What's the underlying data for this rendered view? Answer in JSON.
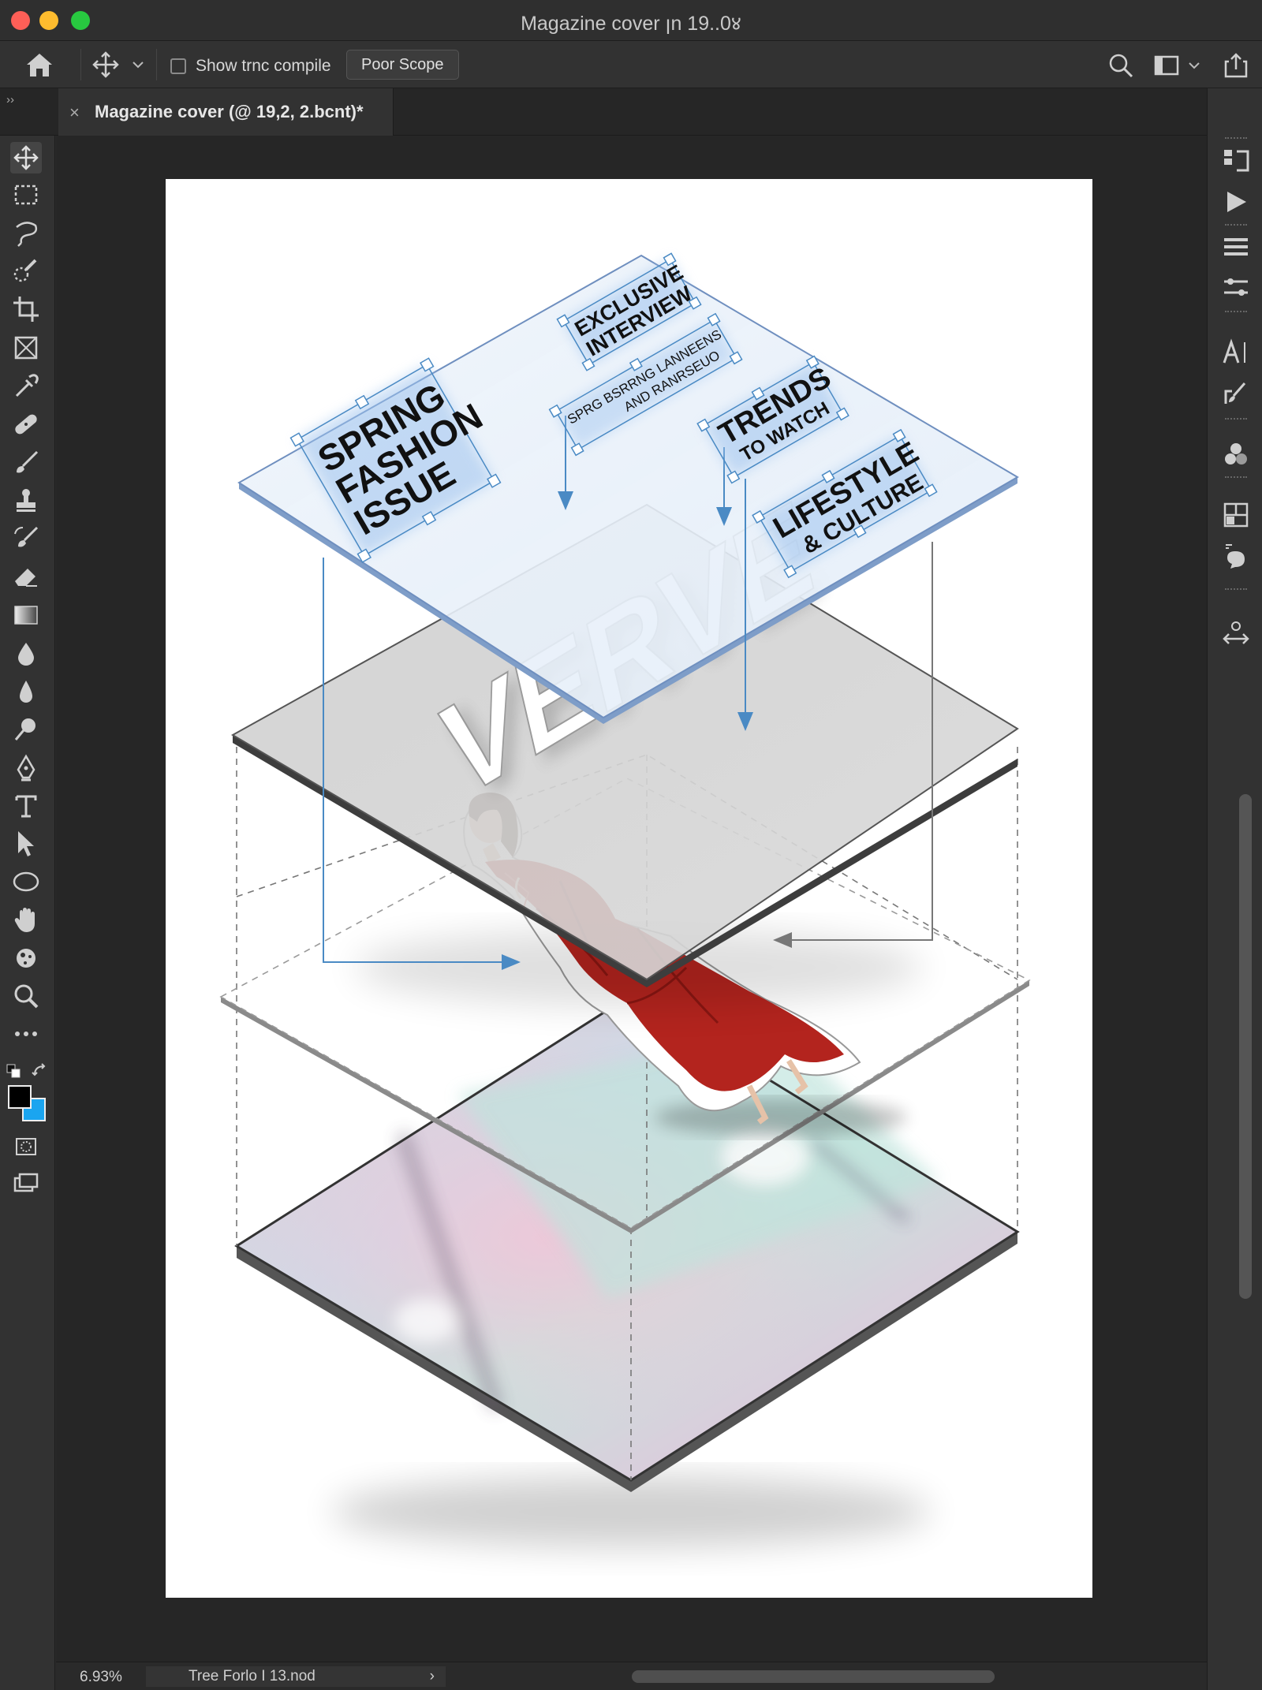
{
  "window": {
    "title": "Magazine cover ꞁn 19..0४"
  },
  "options_bar": {
    "checkbox_label": "Show trnc compile",
    "button_label": "Poor Scope"
  },
  "tab": {
    "close_glyph": "×",
    "label": "Magazine cover (@ 19,2, 2.bcnt)*"
  },
  "panels": {
    "collapse_left": "››",
    "collapse_right": "‹‹"
  },
  "status_bar": {
    "zoom": "6.93%",
    "doc_info": "Tree Forlo I 13.nod",
    "chevron": "›"
  },
  "artwork": {
    "masthead": "VERVE",
    "headline_1": [
      "SPRING",
      "FASHION",
      "ISSUE"
    ],
    "headline_2": [
      "EXCLUSIVE",
      "INTERVIEW"
    ],
    "headline_3": [
      "SPRG BSRRNG LANNEENS",
      "AND RANRSEUO"
    ],
    "headline_4": [
      "TRENDS",
      "TO WATCH"
    ],
    "headline_5": [
      "LIFESTYLE",
      "& CULTURE"
    ]
  },
  "colors": {
    "accent": "#1473e6",
    "foreground_swatch": "#000000",
    "background_swatch": "#1aa5f0",
    "coat": "#b3241e",
    "guide_blue": "#4a8ac4"
  },
  "icons": {
    "left_tools": [
      "move-icon",
      "marquee-icon",
      "lasso-icon",
      "quick-select-icon",
      "crop-icon",
      "frame-icon",
      "eyedropper-icon",
      "healing-icon",
      "brush-icon",
      "stamp-icon",
      "history-brush-icon",
      "eraser-icon",
      "gradient-icon",
      "blur-icon",
      "sharpen-icon",
      "dodge-icon",
      "pen-icon",
      "type-icon",
      "path-select-icon",
      "ellipse-icon",
      "hand-icon",
      "rotate-view-icon",
      "zoom-icon",
      "more-icon"
    ],
    "right_panels": [
      "history-icon",
      "actions-icon",
      "layers-icon",
      "adjustments-icon",
      "character-icon",
      "brush-settings-icon",
      "color-icon",
      "properties-icon",
      "libraries-icon",
      "transform-icon"
    ]
  }
}
